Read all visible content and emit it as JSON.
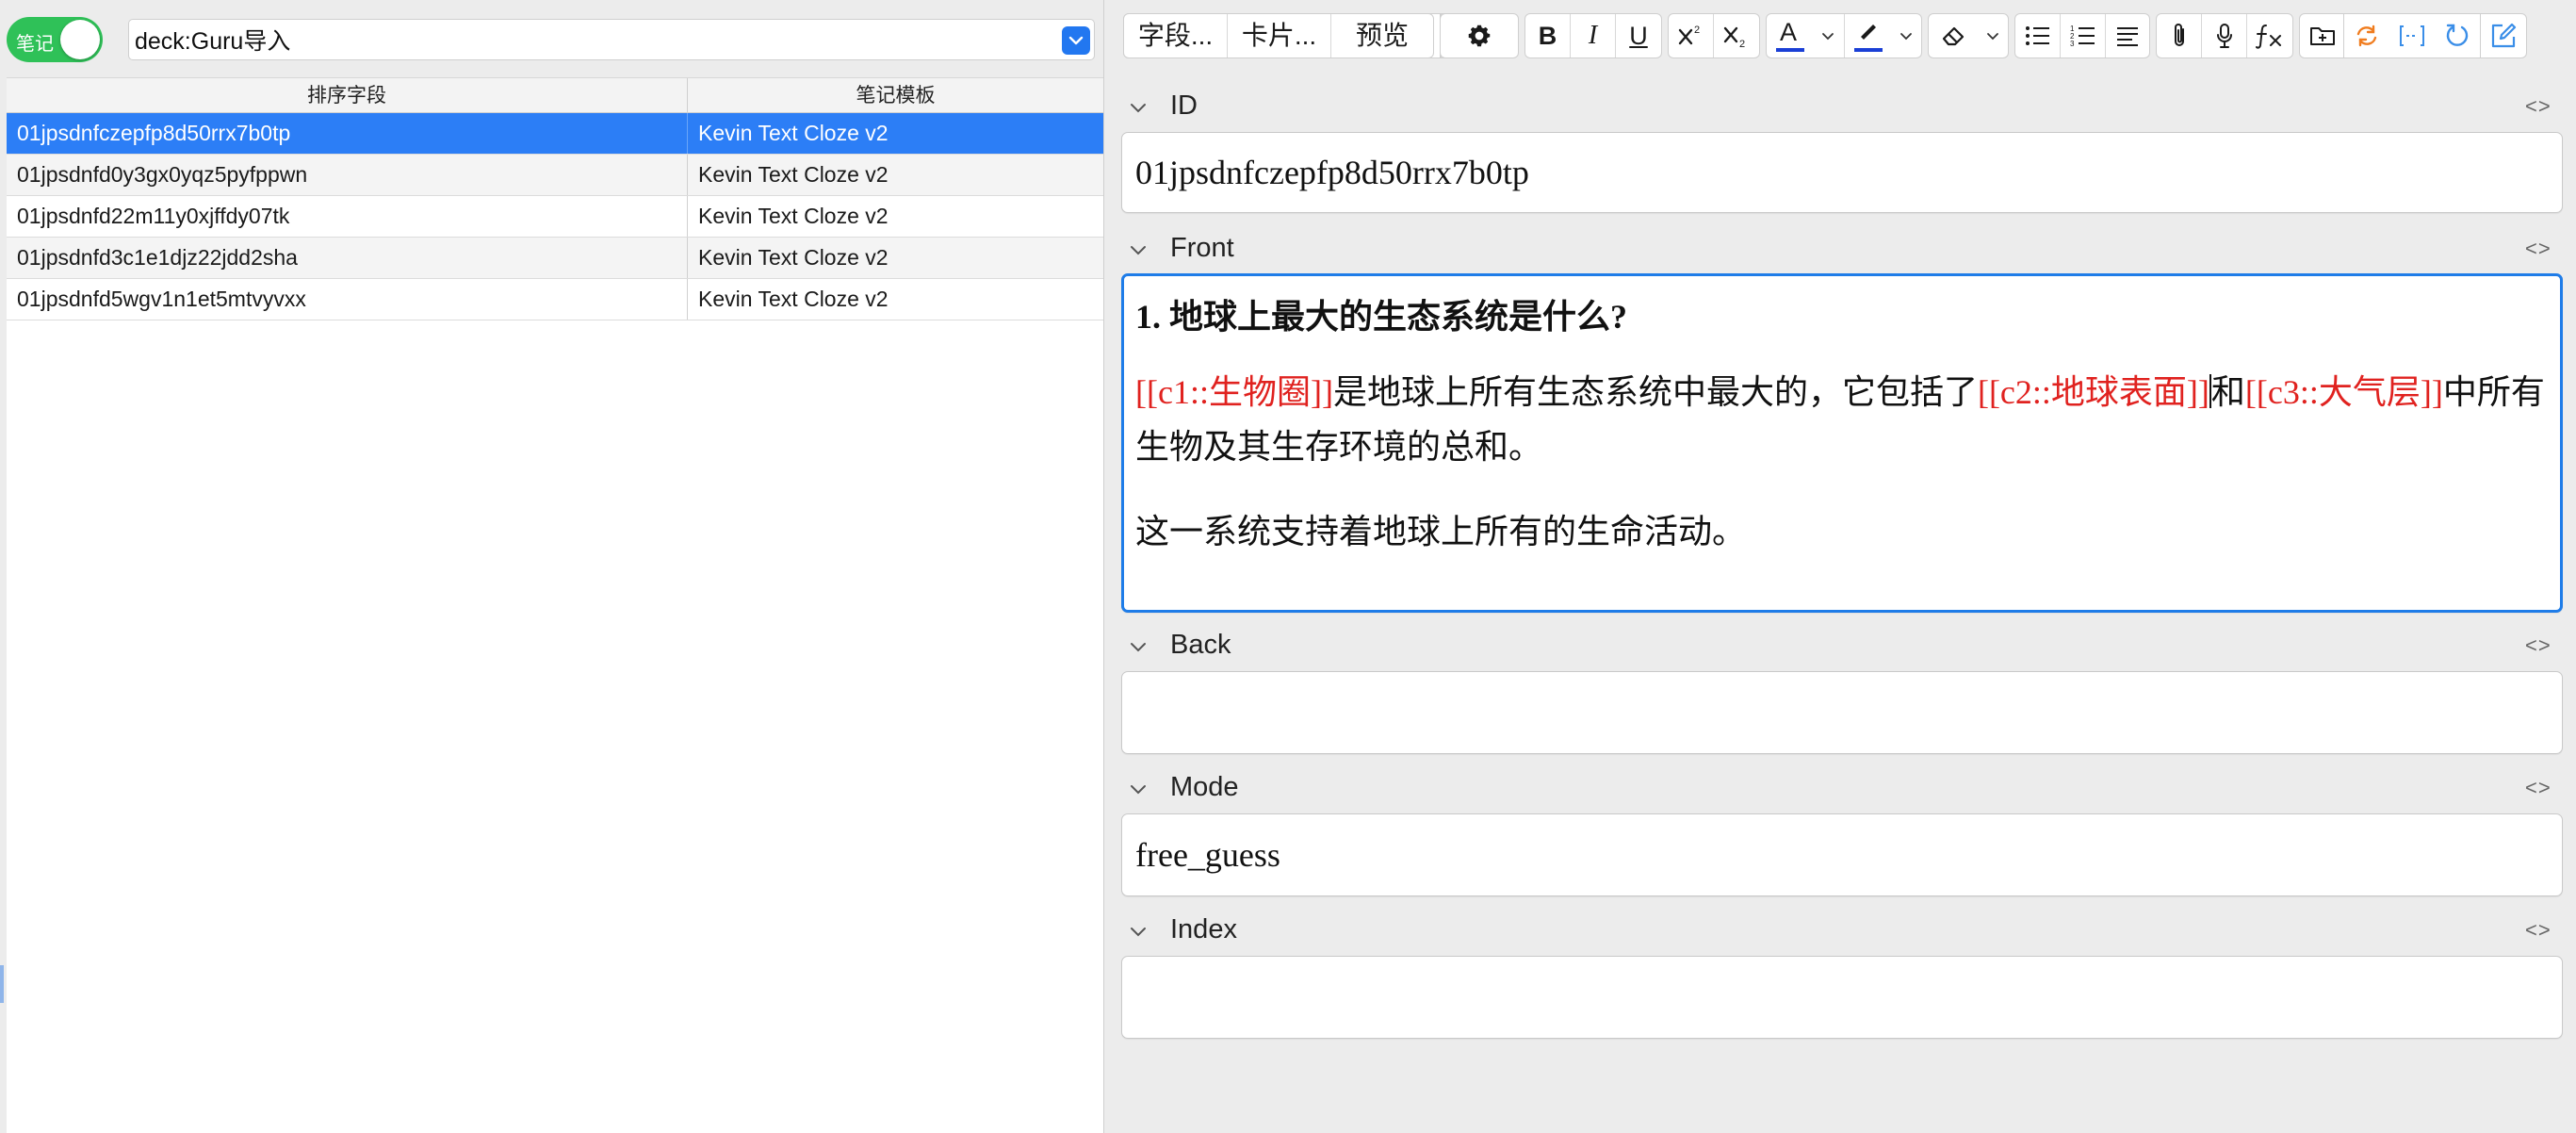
{
  "left": {
    "toggle_label": "笔记",
    "search_value": "deck:Guru导入",
    "columns": [
      "排序字段",
      "笔记模板"
    ],
    "rows": [
      {
        "sort_field": "01jpsdnfczepfp8d50rrx7b0tp",
        "template": "Kevin Text Cloze v2"
      },
      {
        "sort_field": "01jpsdnfd0y3gx0yqz5pyfppwn",
        "template": "Kevin Text Cloze v2"
      },
      {
        "sort_field": "01jpsdnfd22m11y0xjffdy07tk",
        "template": "Kevin Text Cloze v2"
      },
      {
        "sort_field": "01jpsdnfd3c1e1djz22jdd2sha",
        "template": "Kevin Text Cloze v2"
      },
      {
        "sort_field": "01jpsdnfd5wgv1n1et5mtvyvxx",
        "template": "Kevin Text Cloze v2"
      }
    ],
    "selected_row": 0
  },
  "toolbar": {
    "fields_label": "字段...",
    "cards_label": "卡片...",
    "preview_label": "预览",
    "bold": "B",
    "italic": "I",
    "underline": "U",
    "text_color": "A",
    "text_color_hex": "#1a3fd6",
    "highlight_hex": "#1a3fd6",
    "cloze_hex": "#3a8ee8",
    "accent_orange": "#f07c1e"
  },
  "fields": {
    "code_toggle": "<>",
    "id": {
      "label": "ID",
      "value": "01jpsdnfczepfp8d50rrx7b0tp"
    },
    "front": {
      "label": "Front",
      "question": "1. 地球上最大的生态系统是什么?",
      "cloze1": "[[c1::生物圈]]",
      "text1": "是地球上所有生态系统中最大的，它包括了",
      "cloze2": "[[c2::地球表面]]",
      "text2": "和",
      "cloze3": "[[c3::大气层]]",
      "text3": "中所有生物及其生存环境的总和。",
      "para2": "这一系统支持着地球上所有的生命活动。"
    },
    "back": {
      "label": "Back",
      "value": ""
    },
    "mode": {
      "label": "Mode",
      "value": "free_guess"
    },
    "index": {
      "label": "Index",
      "value": ""
    }
  }
}
